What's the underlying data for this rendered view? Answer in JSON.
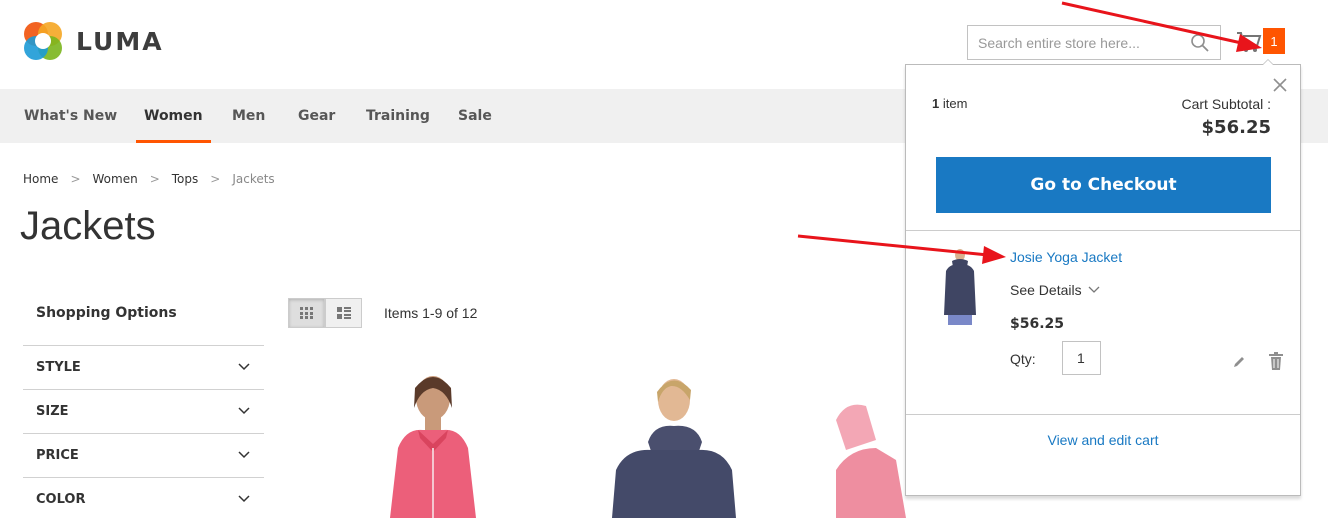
{
  "header": {
    "logo_text": "LUMA",
    "search_placeholder": "Search entire store here...",
    "cart_count": "1"
  },
  "nav": {
    "items": [
      {
        "label": "What's New"
      },
      {
        "label": "Women",
        "active": true
      },
      {
        "label": "Men"
      },
      {
        "label": "Gear"
      },
      {
        "label": "Training"
      },
      {
        "label": "Sale"
      }
    ]
  },
  "breadcrumbs": [
    "Home",
    "Women",
    "Tops",
    "Jackets"
  ],
  "page_title": "Jackets",
  "sidebar": {
    "title": "Shopping Options",
    "filters": [
      "STYLE",
      "SIZE",
      "PRICE",
      "COLOR"
    ]
  },
  "toolbar": {
    "amount": "Items 1-9 of 12"
  },
  "minicart": {
    "count_number": "1",
    "count_label": "item",
    "subtotal_label": "Cart Subtotal :",
    "subtotal_value": "$56.25",
    "checkout_label": "Go to Checkout",
    "item": {
      "name": "Josie Yoga Jacket",
      "details_label": "See Details",
      "price": "$56.25",
      "qty_label": "Qty:",
      "qty_value": "1"
    },
    "view_cart_label": "View and edit cart"
  },
  "colors": {
    "accent": "#ff5501",
    "primary_button": "#1979c3",
    "nav_background": "#f0f0f0",
    "annotation_arrow": "#e8141b"
  }
}
